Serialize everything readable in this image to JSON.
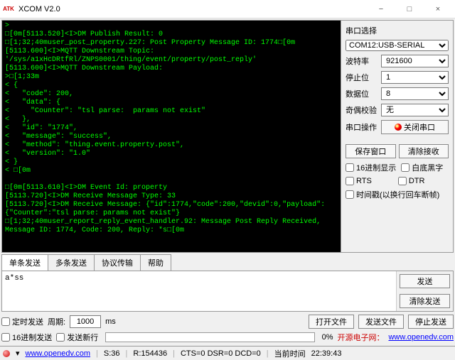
{
  "window": {
    "title": "XCOM V2.0",
    "icon_label": "ATK"
  },
  "terminal_text": ">\n□[0m[5113.520]<I>DM Publish Result: 0\n□[1;32;40muser_post_property.227: Post Property Message ID: 1774□[0m\n[5113.600]<I>MQTT Downstream Topic:\n'/sys/a1xHcDRtfRl/ZNPS0001/thing/event/property/post_reply'\n[5113.600]<I>MQTT Downstream Payload:\n>□[1;33m\n< {\n<   \"code\": 200,\n<   \"data\": {\n<     \"Counter\": \"tsl parse:  params not exist\"\n<   },\n<   \"id\": \"1774\",\n<   \"message\": \"success\",\n<   \"method\": \"thing.event.property.post\",\n<   \"version\": \"1.0\"\n< }\n< □[0m\n\n□[0m[5113.610]<I>DM Event Id: property\n[5113.720]<I>DM Receive Message Type: 33\n[5113.720]<I>DM Receive Message: {\"id\":1774,\"code\":200,\"devid\":0,\"payload\":{\"Counter\":\"tsl parse: params not exist\"}\n□[1;32;40muser_report_reply_event_handler.92: Message Post Reply Received, Message ID: 1774, Code: 200, Reply: *s□[0m",
  "side": {
    "group_title": "串口选择",
    "port": "COM12:USB-SERIAL",
    "baud_label": "波特率",
    "baud": "921600",
    "stop_label": "停止位",
    "stop": "1",
    "data_label": "数据位",
    "data": "8",
    "parity_label": "奇偶校验",
    "parity": "无",
    "op_label": "串口操作",
    "op_button": "关闭串口",
    "save_win": "保存窗口",
    "clear_recv": "清除接收",
    "hex_disp": "16进制显示",
    "white_bg": "白底黑字",
    "rts": "RTS",
    "dtr": "DTR",
    "timestamp": "时间戳(以换行回车断帧)"
  },
  "tabs": [
    "单条发送",
    "多条发送",
    "协议传输",
    "帮助"
  ],
  "send_text": "a*ss",
  "send_btns": {
    "send": "发送",
    "clear": "清除发送"
  },
  "lower": {
    "timed_send": "定时发送",
    "period_label": "周期:",
    "period_value": "1000",
    "period_unit": "ms",
    "open_file": "打开文件",
    "send_file": "发送文件",
    "stop_send": "停止发送",
    "hex_send": "16进制发送",
    "send_newline": "发送新行",
    "progress_pct": "0%",
    "link_label": "开源电子网：",
    "link_url": "www.openedv.com"
  },
  "status": {
    "url": "www.openedv.com",
    "s": "S:36",
    "r": "R:154436",
    "cts": "CTS=0 DSR=0 DCD=0",
    "time_label": "当前时间",
    "time_value": "22:39:43"
  }
}
